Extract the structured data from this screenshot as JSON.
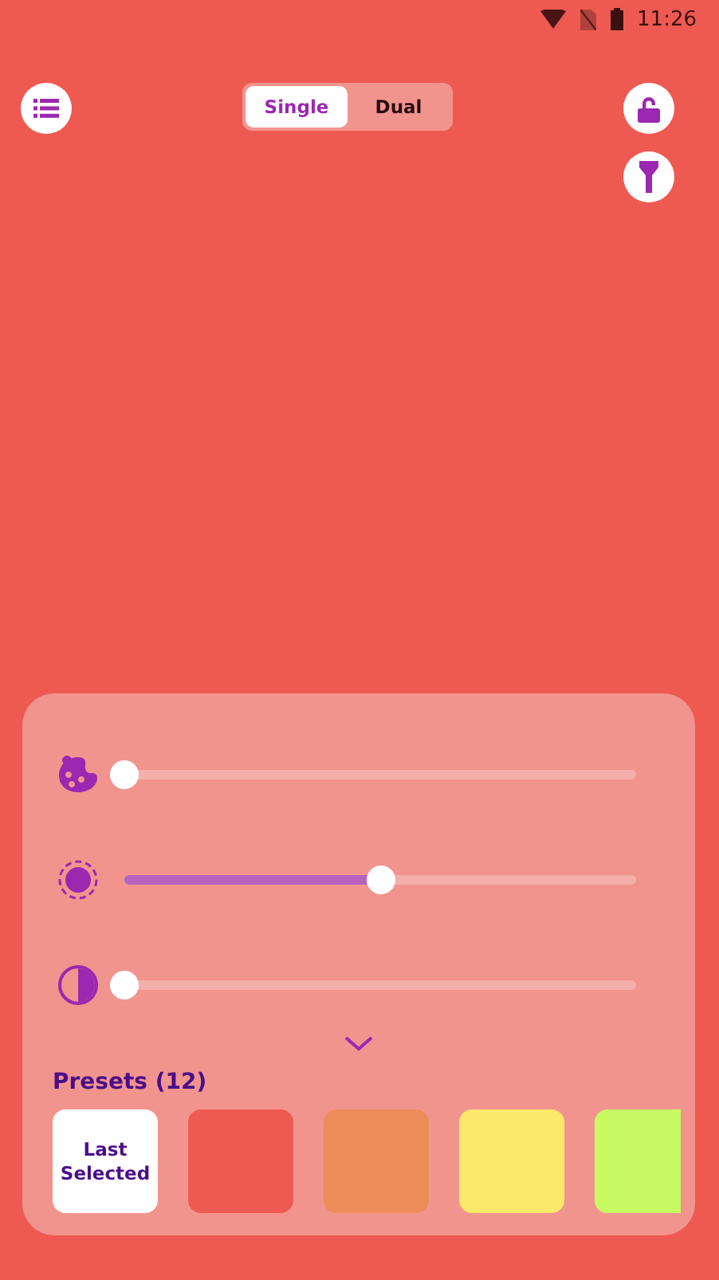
{
  "status_bar": {
    "time": "11:26"
  },
  "mode_toggle": [
    {
      "label": "Single",
      "selected": true
    },
    {
      "label": "Dual",
      "selected": false
    }
  ],
  "sliders": [
    {
      "kind": "hue",
      "level": 0
    },
    {
      "kind": "brightness",
      "level": 0.5
    },
    {
      "kind": "contrast",
      "level": 0
    }
  ],
  "presets": {
    "title": "Presets (12)",
    "items": [
      {
        "kind": "last",
        "label": "Last Selected"
      },
      {
        "kind": "color",
        "color": "#ee5a52"
      },
      {
        "kind": "color",
        "color": "#ec8c58"
      },
      {
        "kind": "color",
        "color": "#fce86a"
      },
      {
        "kind": "color",
        "color": "#c8fa64"
      }
    ]
  }
}
